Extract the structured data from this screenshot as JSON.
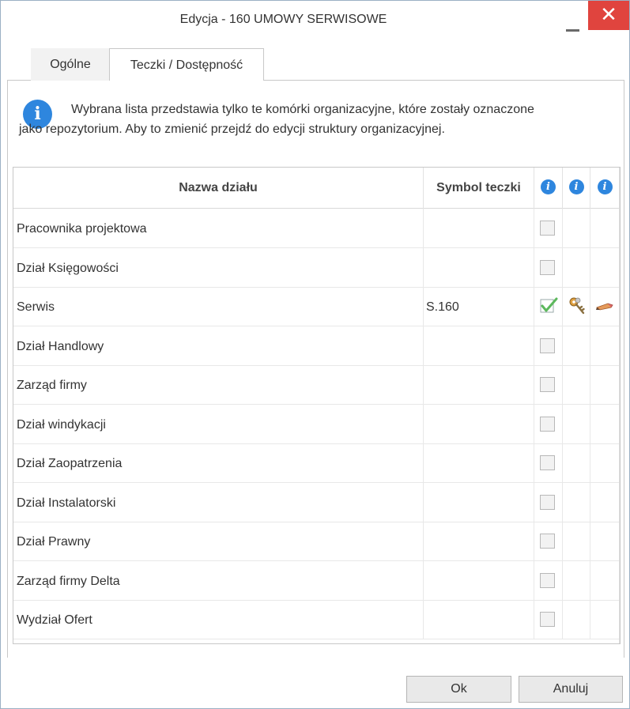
{
  "window": {
    "title": "Edycja - 160 UMOWY SERWISOWE",
    "close_glyph": "✕"
  },
  "tabs": [
    {
      "label": "Ogólne",
      "active": false
    },
    {
      "label": "Teczki / Dostępność",
      "active": true
    }
  ],
  "info": {
    "icon_glyph": "i",
    "text": "Wybrana lista przedstawia tylko te komórki organizacyjne, które zostały oznaczone jako repozytorium. Aby to zmienić przejdź do edycji struktury organizacyjnej."
  },
  "table": {
    "headers": {
      "name": "Nazwa działu",
      "symbol": "Symbol teczki",
      "info_glyph": "i"
    },
    "rows": [
      {
        "name": "Pracownika projektowa",
        "symbol": "",
        "checked": false
      },
      {
        "name": "Dział Księgowości",
        "symbol": "",
        "checked": false
      },
      {
        "name": "Serwis",
        "symbol": "S.160",
        "checked": true
      },
      {
        "name": "Dział Handlowy",
        "symbol": "",
        "checked": false
      },
      {
        "name": "Zarząd firmy",
        "symbol": "",
        "checked": false
      },
      {
        "name": "Dział windykacji",
        "symbol": "",
        "checked": false
      },
      {
        "name": "Dział Zaopatrzenia",
        "symbol": "",
        "checked": false
      },
      {
        "name": "Dział Instalatorski",
        "symbol": "",
        "checked": false
      },
      {
        "name": "Dział Prawny",
        "symbol": "",
        "checked": false
      },
      {
        "name": "Zarząd firmy Delta",
        "symbol": "",
        "checked": false
      },
      {
        "name": "Wydział Ofert",
        "symbol": "",
        "checked": false
      }
    ]
  },
  "buttons": {
    "ok": "Ok",
    "cancel": "Anuluj"
  },
  "colors": {
    "accent": "#2e86de",
    "close": "#e0443e",
    "check": "#5cb85c"
  }
}
